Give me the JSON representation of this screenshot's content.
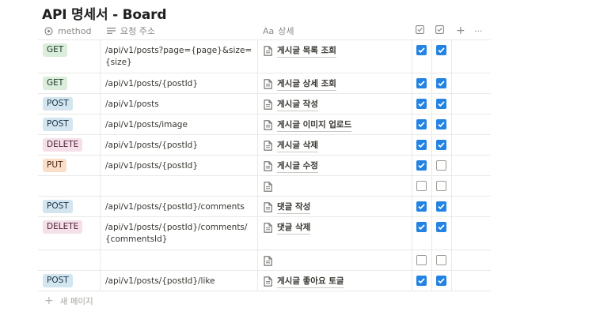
{
  "page": {
    "title": "API 명세서 - Board"
  },
  "table": {
    "headers": {
      "method": "method",
      "path": "요청 주소",
      "detail_prefix": "Aa",
      "detail": "상세",
      "add": "+",
      "more": "···"
    },
    "rows": [
      {
        "method": "GET",
        "path": "/api/v1/posts?page={page}&size={size}",
        "detail": "게시글 목록 조회",
        "c1": true,
        "c2": true
      },
      {
        "method": "GET",
        "path": "/api/v1/posts/{postId}",
        "detail": "게시글 상세 조회",
        "c1": true,
        "c2": true
      },
      {
        "method": "POST",
        "path": "/api/v1/posts",
        "detail": "게시글 작성",
        "c1": true,
        "c2": true
      },
      {
        "method": "POST",
        "path": "/api/v1/posts/image",
        "detail": "게시글 이미지 업로드",
        "c1": true,
        "c2": true
      },
      {
        "method": "DELETE",
        "path": "/api/v1/posts/{postId}",
        "detail": "게시글 삭제",
        "c1": true,
        "c2": true
      },
      {
        "method": "PUT",
        "path": "/api/v1/posts/{postId}",
        "detail": "게시글 수정",
        "c1": true,
        "c2": false
      },
      {
        "method": "",
        "path": "",
        "detail": "",
        "c1": false,
        "c2": false
      },
      {
        "method": "POST",
        "path": "/api/v1/posts/{postId}/comments",
        "detail": "댓글 작성",
        "c1": true,
        "c2": true
      },
      {
        "method": "DELETE",
        "path": "/api/v1/posts/{postId}/comments/{commentsId}",
        "detail": "댓글 삭제",
        "c1": true,
        "c2": true
      },
      {
        "method": "",
        "path": "",
        "detail": "",
        "c1": false,
        "c2": false
      },
      {
        "method": "POST",
        "path": "/api/v1/posts/{postId}/like",
        "detail": "게시글 좋아요 토글",
        "c1": true,
        "c2": true
      }
    ],
    "new_page": "새 페이지"
  },
  "colors": {
    "GET": {
      "bg": "#dbeddb",
      "fg": "#1c3829"
    },
    "POST": {
      "bg": "#d3e5ef",
      "fg": "#183347"
    },
    "DELETE": {
      "bg": "#f5e0e9",
      "fg": "#4c2337"
    },
    "PUT": {
      "bg": "#fadec9",
      "fg": "#49290e"
    },
    "checkbox_on": "#2383e2"
  },
  "icons": {
    "method": "circle-dot-icon",
    "path": "text-lines-icon",
    "detail": "page-icon",
    "check_column": "checkbox-icon",
    "add": "plus-icon",
    "more": "ellipsis-icon"
  }
}
